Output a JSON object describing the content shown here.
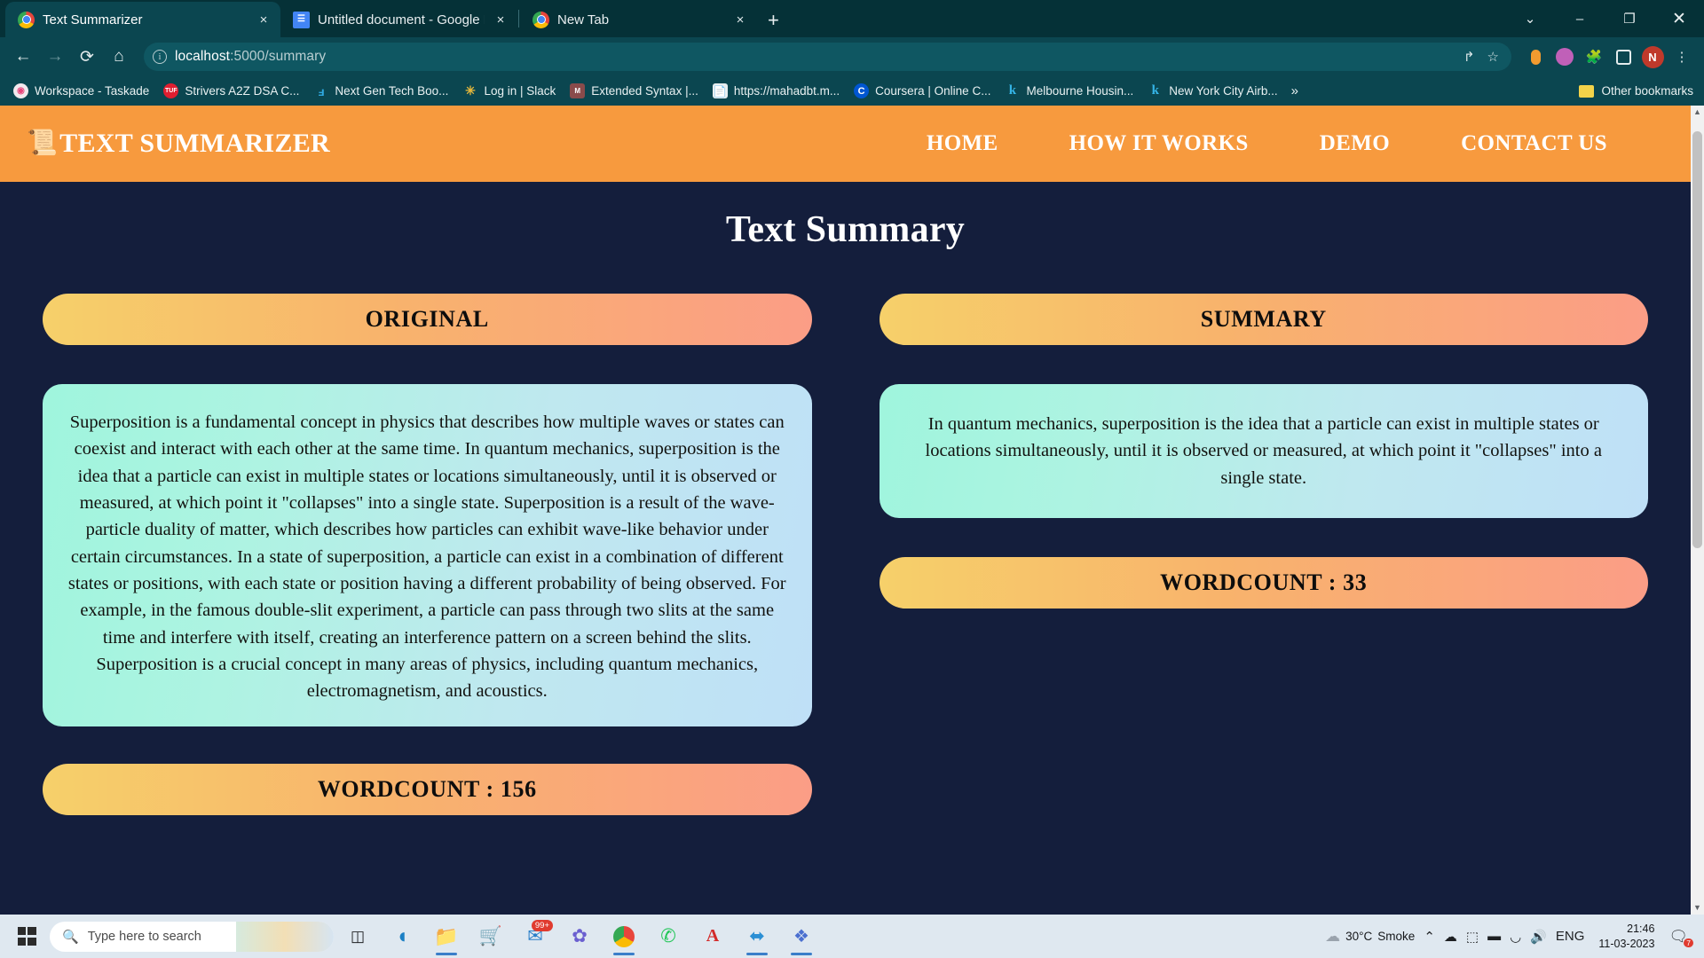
{
  "browser": {
    "tabs": [
      {
        "title": "Text Summarizer",
        "favicon": "chrome-icon",
        "active": true,
        "close": "×"
      },
      {
        "title": "Untitled document - Google Doc",
        "favicon": "google-docs-icon",
        "active": false,
        "close": "×"
      },
      {
        "title": "New Tab",
        "favicon": "chrome-icon",
        "active": false,
        "close": "×"
      }
    ],
    "new_tab_label": "+",
    "window_controls": {
      "minimize_all": "⌄",
      "minimize": "–",
      "maximize": "❐",
      "close": "✕"
    },
    "nav": {
      "back": "←",
      "forward": "→",
      "reload": "⟳",
      "home": "⌂"
    },
    "omnibox": {
      "info_icon": "i",
      "url_host": "localhost",
      "url_path": ":5000/summary",
      "share_icon": "↱",
      "bookmark_icon": "☆"
    },
    "toolbar_icons": [
      "password-key-icon",
      "extension-profile-icon",
      "extensions-puzzle-icon",
      "sidepanel-icon",
      "profile-avatar",
      "chrome-menu-icon"
    ],
    "profile_initial": "N",
    "menu_icon": "⋮",
    "bookmarks": [
      {
        "label": "Workspace - Taskade",
        "icon": "taskade-icon",
        "color": "#e8467c",
        "glyph": "◉"
      },
      {
        "label": "Strivers A2Z DSA C...",
        "icon": "takeuforward-icon",
        "color": "#e01e30",
        "glyph": "TUF"
      },
      {
        "label": "Next Gen Tech Boo...",
        "icon": "udacity-icon",
        "color": "#0b4650",
        "glyph": "U"
      },
      {
        "label": "Log in | Slack",
        "icon": "slack-icon",
        "color": "#0b4650",
        "glyph": "✳"
      },
      {
        "label": "Extended Syntax |...",
        "icon": "markdown-icon",
        "color": "#7d3b3b",
        "glyph": "M↓"
      },
      {
        "label": "https://mahadbt.m...",
        "icon": "document-icon",
        "color": "#dfe6ea",
        "glyph": "☰"
      },
      {
        "label": "Coursera | Online C...",
        "icon": "coursera-icon",
        "color": "#0056d2",
        "glyph": "C"
      },
      {
        "label": "Melbourne Housin...",
        "icon": "kaggle-icon",
        "color": "#0b4650",
        "glyph": "k"
      },
      {
        "label": "New York City Airb...",
        "icon": "kaggle-icon",
        "color": "#0b4650",
        "glyph": "k"
      }
    ],
    "bookmarks_overflow": "»",
    "other_bookmarks": "Other bookmarks"
  },
  "site": {
    "brand": {
      "icon": "📜",
      "name": "TEXT SUMMARIZER"
    },
    "nav_links": [
      "HOME",
      "HOW IT WORKS",
      "DEMO",
      "CONTACT US"
    ],
    "page_title": "Text Summary",
    "original": {
      "heading": "ORIGINAL",
      "text": "Superposition is a fundamental concept in physics that describes how multiple waves or states can coexist and interact with each other at the same time. In quantum mechanics, superposition is the idea that a particle can exist in multiple states or locations simultaneously, until it is observed or measured, at which point it \"collapses\" into a single state. Superposition is a result of the wave-particle duality of matter, which describes how particles can exhibit wave-like behavior under certain circumstances. In a state of superposition, a particle can exist in a combination of different states or positions, with each state or position having a different probability of being observed. For example, in the famous double-slit experiment, a particle can pass through two slits at the same time and interfere with itself, creating an interference pattern on a screen behind the slits. Superposition is a crucial concept in many areas of physics, including quantum mechanics, electromagnetism, and acoustics.",
      "wordcount_label": "WORDCOUNT : 156"
    },
    "summary": {
      "heading": "SUMMARY",
      "text": "In quantum mechanics, superposition is the idea that a particle can exist in multiple states or locations simultaneously, until it is observed or measured, at which point it \"collapses\" into a single state.",
      "wordcount_label": "WORDCOUNT : 33"
    },
    "colors": {
      "header_bg": "#f79a3e",
      "page_bg": "#141e3c",
      "band_gradient_start": "#f6d06a",
      "band_gradient_end": "#fb9d86",
      "panel_gradient_start": "#9ff5dd",
      "panel_gradient_end": "#bfe0f7"
    }
  },
  "taskbar": {
    "start_label": "start-button",
    "search_placeholder": "Type here to search",
    "apps": [
      {
        "name": "task-view",
        "glyph": "□"
      },
      {
        "name": "edge",
        "glyph": "◑"
      },
      {
        "name": "file-explorer",
        "glyph": "🗂"
      },
      {
        "name": "microsoft-store",
        "glyph": "🛒"
      },
      {
        "name": "mail",
        "glyph": "✉",
        "badge": "99+"
      },
      {
        "name": "photos",
        "glyph": "✿"
      },
      {
        "name": "chrome",
        "glyph": "◯"
      },
      {
        "name": "whatsapp",
        "glyph": "✆"
      },
      {
        "name": "adobe-acrobat",
        "glyph": "A"
      },
      {
        "name": "visual-studio-code",
        "glyph": "⬌"
      },
      {
        "name": "teams",
        "glyph": "❖"
      }
    ],
    "weather": {
      "temp": "30°C",
      "condition": "Smoke"
    },
    "tray": {
      "chevron": "⌃",
      "cloud": "☁",
      "onedrive": "⬚",
      "battery": "▬",
      "wifi": "◡",
      "volume": "🔊",
      "language": "ENG"
    },
    "clock": {
      "time": "21:46",
      "date": "11-03-2023"
    },
    "notification_count": "7"
  }
}
